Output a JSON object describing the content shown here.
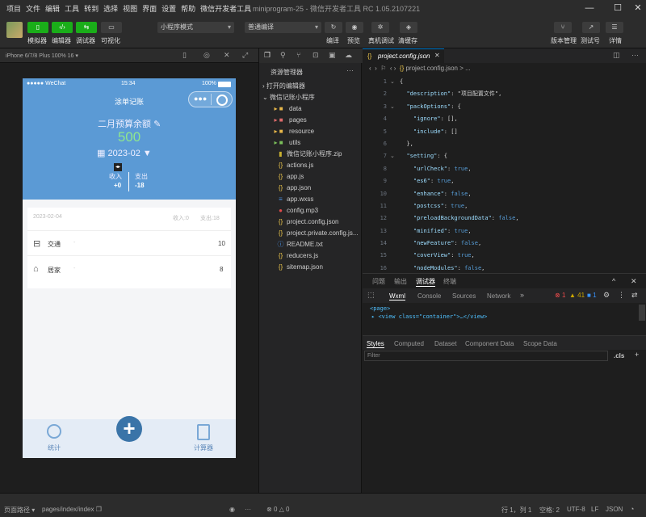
{
  "menu": [
    "项目",
    "文件",
    "编辑",
    "工具",
    "转到",
    "选择",
    "视图",
    "界面",
    "设置",
    "帮助",
    "微信开发者工具"
  ],
  "window_title": "miniprogram-25 - 微信开发者工具 RC 1.05.2107221",
  "toolbar": {
    "simulator": "模拟器",
    "editor": "编辑器",
    "debugger": "调试器",
    "visual": "可视化",
    "mode_select": "小程序模式",
    "compile_select": "普通编译",
    "compile": "编译",
    "preview": "预览",
    "realdebug": "真机调试",
    "clear": "清缓存",
    "version": "版本管理",
    "test": "测试号",
    "details": "详情"
  },
  "sim": {
    "device": "iPhone 6/7/8 Plus 100% 16"
  },
  "phone": {
    "carrier": "●●●●● WeChat",
    "time": "15:34",
    "battery": "100%",
    "nav_title": "涂单记账",
    "budget_label": "二月预算余额",
    "budget_value": "500",
    "month": "2023-02",
    "income_label": "收入",
    "income_value": "+0",
    "expense_label": "支出",
    "expense_value": "-18",
    "day": {
      "date": "2023-02-04",
      "income": "收入:0",
      "expense": "支出:18"
    },
    "items": [
      {
        "name": "交通",
        "amount": "10",
        "icon": "bus-icon"
      },
      {
        "name": "居家",
        "amount": "8",
        "icon": "home-icon"
      }
    ],
    "tab_stats": "统计",
    "tab_calc": "计算器"
  },
  "explorer": {
    "title": "资源管理器",
    "open_editors": "打开的编辑器",
    "project": "微信记账小程序",
    "files": [
      {
        "name": "data",
        "type": "folder",
        "color": "#e8b84a"
      },
      {
        "name": "pages",
        "type": "folder",
        "color": "#e06c6c"
      },
      {
        "name": "resource",
        "type": "folder",
        "color": "#e8b84a"
      },
      {
        "name": "utils",
        "type": "folder",
        "color": "#7bbf5a"
      },
      {
        "name": "微信记账小程序.zip",
        "type": "zip",
        "color": "#c8b030"
      },
      {
        "name": "actions.js",
        "type": "js",
        "color": "#e8c34a"
      },
      {
        "name": "app.js",
        "type": "js",
        "color": "#e8c34a"
      },
      {
        "name": "app.json",
        "type": "json",
        "color": "#e8c34a"
      },
      {
        "name": "app.wxss",
        "type": "wxss",
        "color": "#4a8fe0"
      },
      {
        "name": "config.mp3",
        "type": "mp3",
        "color": "#e04a4a"
      },
      {
        "name": "project.config.json",
        "type": "json",
        "color": "#e8c34a"
      },
      {
        "name": "project.private.config.js...",
        "type": "json",
        "color": "#e8c34a"
      },
      {
        "name": "README.txt",
        "type": "txt",
        "color": "#4a8fe0"
      },
      {
        "name": "reducers.js",
        "type": "js",
        "color": "#e8c34a"
      },
      {
        "name": "sitemap.json",
        "type": "json",
        "color": "#e8c34a"
      }
    ],
    "outline": "大纲"
  },
  "editor": {
    "tab": "project.config.json",
    "breadcrumb": "project.config.json > ...",
    "lines": [
      {
        "n": "1",
        "t": "{"
      },
      {
        "n": "2",
        "t": "  \"description\": \"项目配置文件\","
      },
      {
        "n": "3",
        "t": "  \"packOptions\": {"
      },
      {
        "n": "4",
        "t": "    \"ignore\": [],"
      },
      {
        "n": "5",
        "t": "    \"include\": []"
      },
      {
        "n": "6",
        "t": "  },"
      },
      {
        "n": "7",
        "t": "  \"setting\": {"
      },
      {
        "n": "8",
        "t": "    \"urlCheck\": true,"
      },
      {
        "n": "9",
        "t": "    \"es6\": true,"
      },
      {
        "n": "10",
        "t": "    \"enhance\": false,"
      },
      {
        "n": "11",
        "t": "    \"postcss\": true,"
      },
      {
        "n": "12",
        "t": "    \"preloadBackgroundData\": false,"
      },
      {
        "n": "13",
        "t": "    \"minified\": true,"
      },
      {
        "n": "14",
        "t": "    \"newFeature\": false,"
      },
      {
        "n": "15",
        "t": "    \"coverView\": true,"
      },
      {
        "n": "16",
        "t": "    \"nodeModules\": false,"
      }
    ]
  },
  "debug": {
    "panel_tabs": [
      "问题",
      "输出",
      "调试器",
      "终端"
    ],
    "tool_tabs": [
      "Wxml",
      "Console",
      "Sources",
      "Network"
    ],
    "err": "1",
    "warn": "41",
    "info": "1",
    "tree1": "<page>",
    "tree2": "<view class=\"container\">…</view>",
    "style_tabs": [
      "Styles",
      "Computed",
      "Dataset",
      "Component Data",
      "Scope Data"
    ],
    "filter": "Filter",
    "cls": ".cls"
  },
  "status": {
    "path_label": "页面路径",
    "path": "pages/index/index",
    "problems_err": "0",
    "problems_warn": "0",
    "pos": "行 1，列 1",
    "spaces": "空格: 2",
    "enc": "UTF-8",
    "eol": "LF",
    "lang": "JSON"
  }
}
